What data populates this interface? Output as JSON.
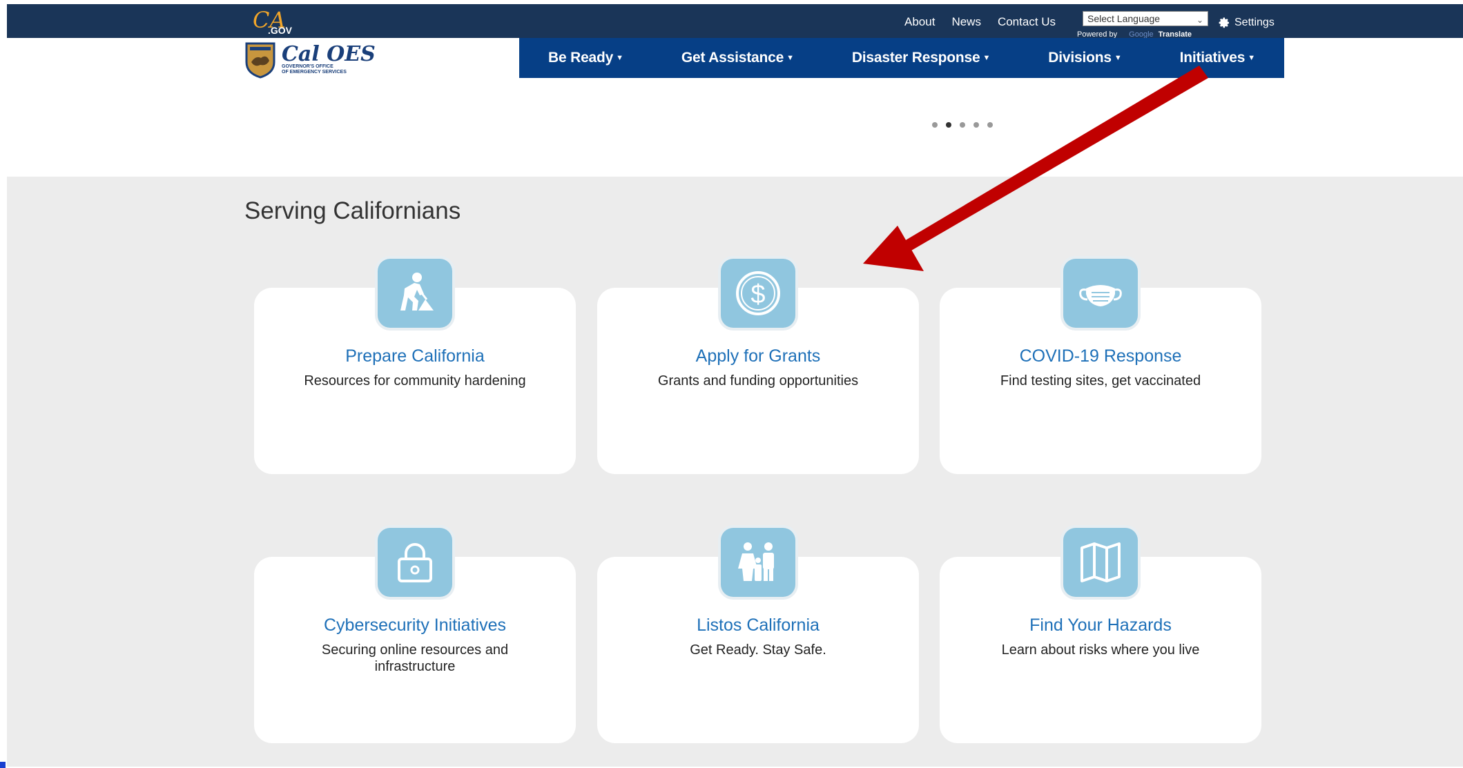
{
  "utility_bar": {
    "ca_logo_ca": "CA",
    "ca_logo_gov": ".GOV",
    "links": [
      "About",
      "News",
      "Contact Us"
    ],
    "language_select": "Select Language",
    "powered_by": "Powered by",
    "google": "Google",
    "translate": "Translate",
    "settings_label": "Settings"
  },
  "brand": {
    "name": "Cal OES",
    "subtitle_line1": "GOVERNOR'S OFFICE",
    "subtitle_line2": "OF EMERGENCY SERVICES"
  },
  "nav": {
    "items": [
      "Be Ready",
      "Get Assistance",
      "Disaster Response",
      "Divisions",
      "Initiatives"
    ]
  },
  "carousel": {
    "dot_count": 5,
    "active_index": 1
  },
  "serving": {
    "title": "Serving Californians",
    "cards": [
      {
        "title": "Prepare California",
        "desc": "Resources for community hardening",
        "icon": "worker-shovel-icon"
      },
      {
        "title": "Apply for Grants",
        "desc": "Grants and funding opportunities",
        "icon": "dollar-coin-icon"
      },
      {
        "title": "COVID-19 Response",
        "desc": "Find testing sites, get vaccinated",
        "icon": "face-mask-icon"
      },
      {
        "title": "Cybersecurity Initiatives",
        "desc": "Securing online resources and infrastructure",
        "icon": "padlock-icon"
      },
      {
        "title": "Listos California",
        "desc": "Get Ready. Stay Safe.",
        "icon": "family-icon"
      },
      {
        "title": "Find Your Hazards",
        "desc": "Learn about risks where you live",
        "icon": "folded-map-icon"
      }
    ]
  },
  "colors": {
    "utility_bar": "#1a3558",
    "nav": "#063f86",
    "card_title": "#1e70b8",
    "icon_tile": "#90c6df",
    "section_bg": "#ececec",
    "annotation_arrow": "#c00000"
  }
}
